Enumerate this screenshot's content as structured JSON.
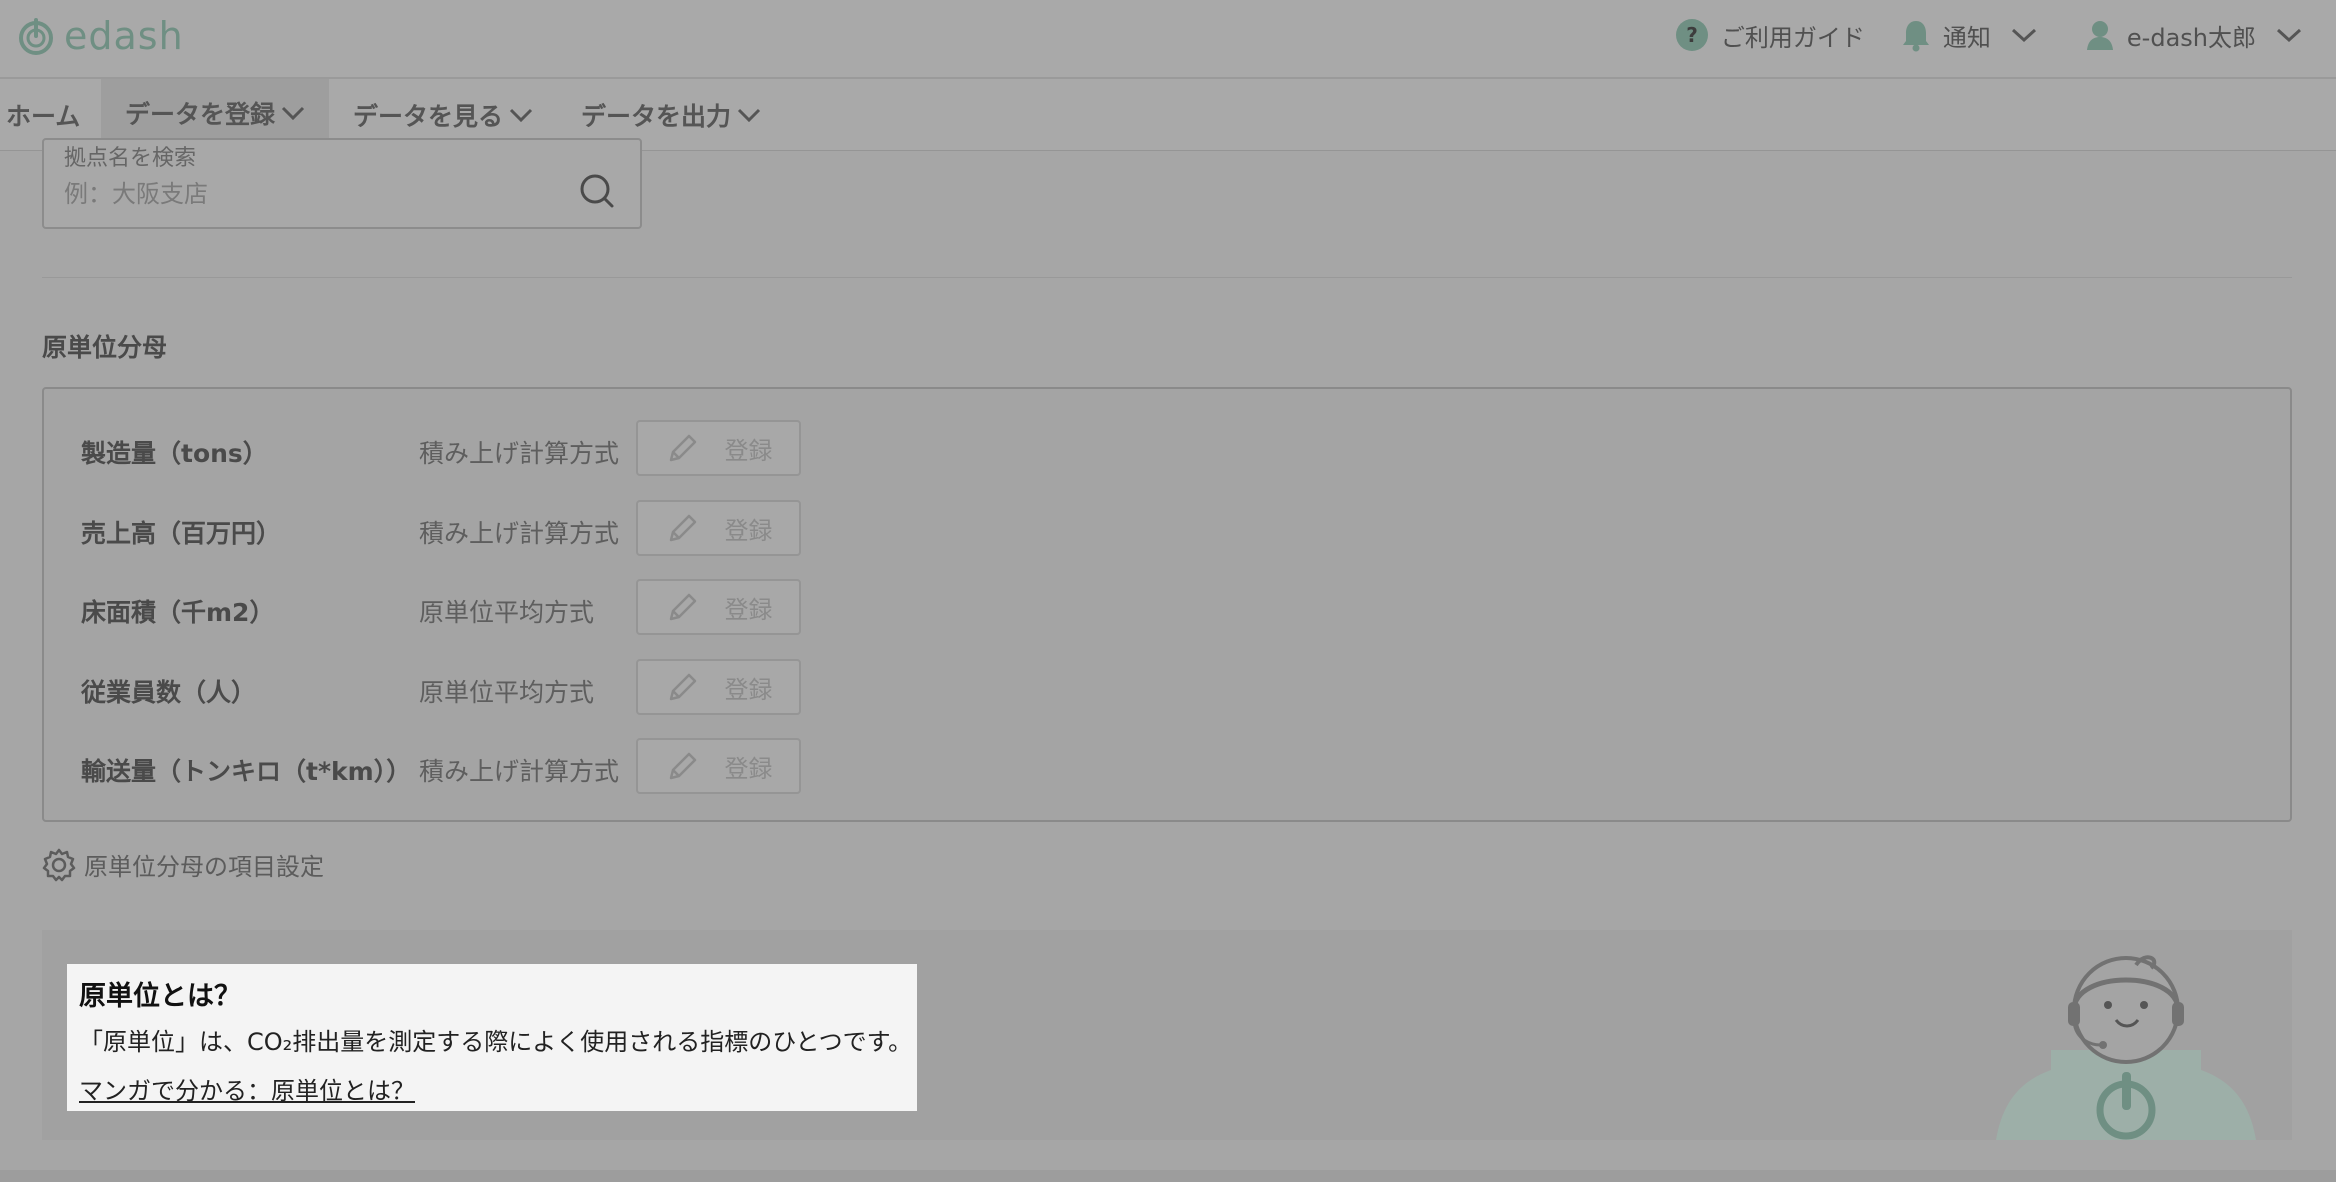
{
  "header": {
    "brand": "edash",
    "guide_label": "ご利用ガイド",
    "notify_label": "通知",
    "user_label": "e-dash太郎"
  },
  "nav": {
    "items": [
      {
        "label": "ホーム"
      },
      {
        "label": "データを登録"
      },
      {
        "label": "データを見る"
      },
      {
        "label": "データを出力"
      }
    ],
    "active_index": 1
  },
  "search": {
    "label": "拠点名を検索",
    "placeholder": "例：大阪支店"
  },
  "denominator": {
    "title": "原単位分母",
    "rows": [
      {
        "name": "製造量（tons）",
        "method": "積み上げ計算方式",
        "button": "登録"
      },
      {
        "name": "売上高（百万円）",
        "method": "積み上げ計算方式",
        "button": "登録"
      },
      {
        "name": "床面積（千m2）",
        "method": "原単位平均方式",
        "button": "登録"
      },
      {
        "name": "従業員数（人）",
        "method": "原単位平均方式",
        "button": "登録"
      },
      {
        "name": "輸送量（トンキロ（t*km））",
        "method": "積み上げ計算方式",
        "button": "登録"
      }
    ],
    "settings_link": "原単位分母の項目設定"
  },
  "info": {
    "title": "原単位とは？",
    "text": "「原単位」は、CO₂排出量を測定する際によく使用される指標のひとつです。",
    "link": "マンガで分かる：原単位とは？"
  },
  "colors": {
    "accent": "#6f8f83",
    "overlay": "#a6a6a6",
    "card": "#f4f4f4"
  }
}
